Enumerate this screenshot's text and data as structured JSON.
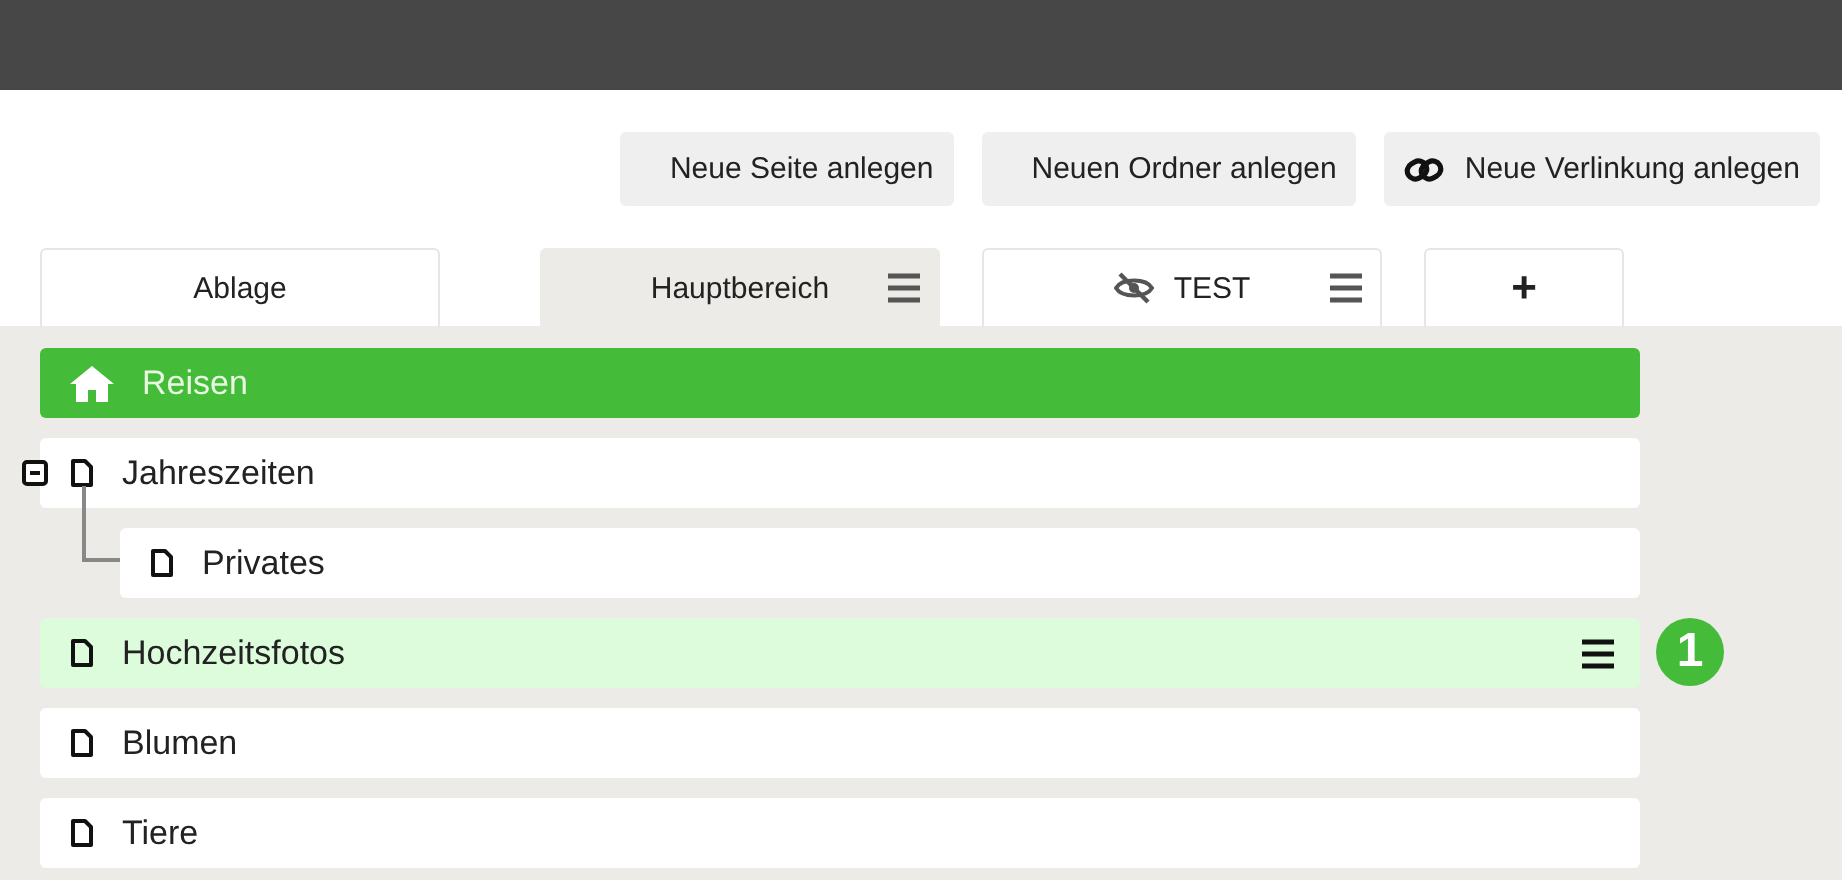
{
  "toolbar": {
    "buttons": [
      {
        "kind": "plain",
        "label": "Neue Seite anlegen"
      },
      {
        "kind": "plain",
        "label": "Neuen Ordner anlegen"
      },
      {
        "kind": "link",
        "label": "Neue Verlinkung anlegen"
      }
    ]
  },
  "tabs": [
    {
      "kind": "area",
      "label": "Ablage",
      "selected": false,
      "hidden": false,
      "menu": false
    },
    {
      "kind": "area",
      "label": "Hauptbereich",
      "selected": true,
      "hidden": false,
      "menu": true
    },
    {
      "kind": "area",
      "label": "TEST",
      "selected": false,
      "hidden": true,
      "menu": true
    },
    {
      "kind": "add",
      "label": "+",
      "selected": false
    }
  ],
  "tree": [
    {
      "kind": "home",
      "label": "Reisen",
      "selected": true,
      "highlighted": false,
      "menu": false
    },
    {
      "kind": "page",
      "label": "Jahreszeiten",
      "selected": false,
      "highlighted": false,
      "menu": false,
      "expanded": true,
      "children": [
        {
          "kind": "page",
          "label": "Privates",
          "selected": false,
          "highlighted": false,
          "menu": false
        }
      ]
    },
    {
      "kind": "page",
      "label": "Hochzeitsfotos",
      "selected": false,
      "highlighted": true,
      "menu": true,
      "badge": "1"
    },
    {
      "kind": "page",
      "label": "Blumen",
      "selected": false,
      "highlighted": false,
      "menu": false
    },
    {
      "kind": "page",
      "label": "Tiere",
      "selected": false,
      "highlighted": false,
      "menu": false
    }
  ]
}
